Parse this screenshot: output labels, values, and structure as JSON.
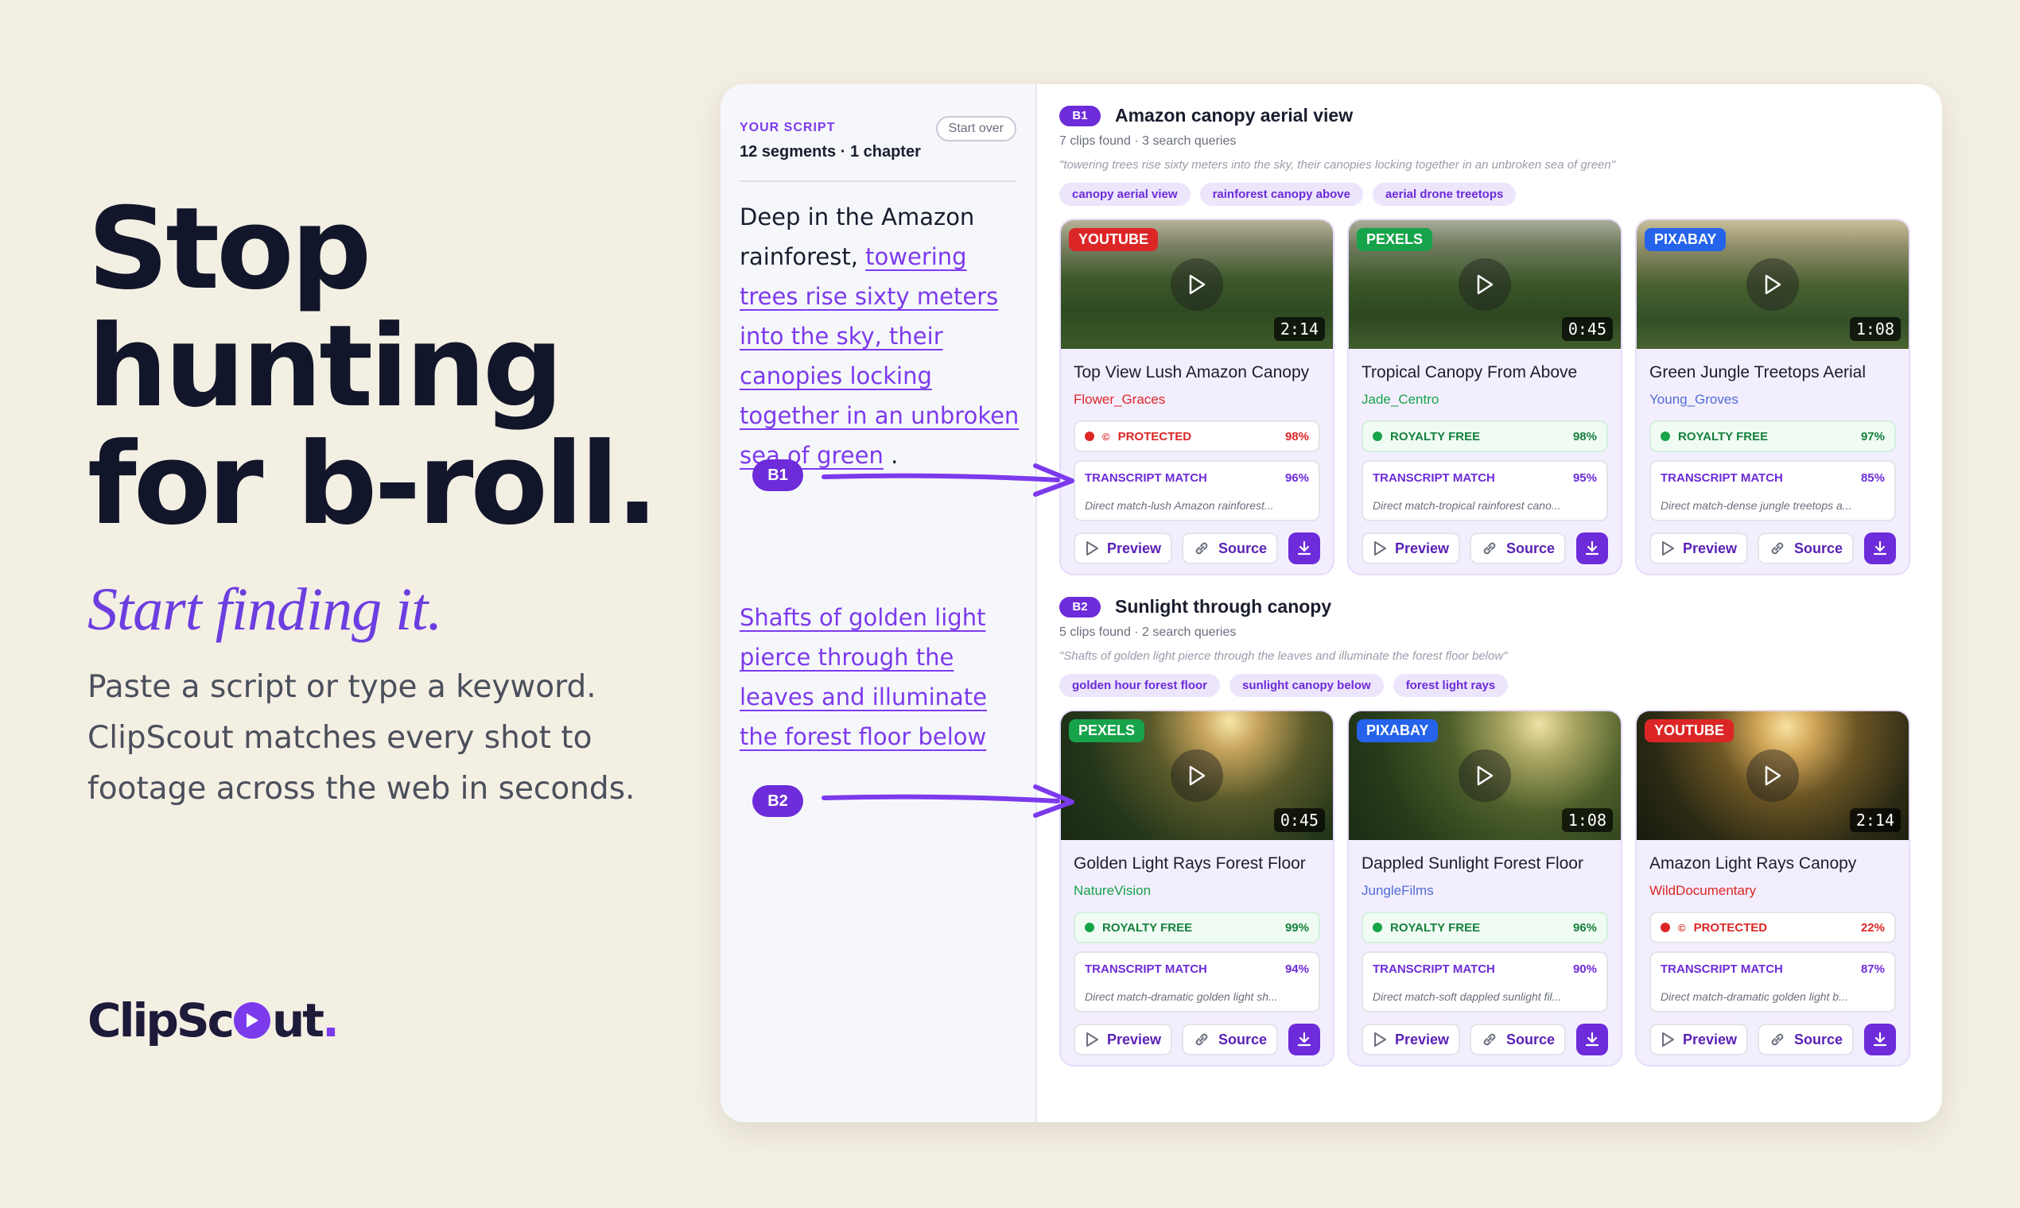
{
  "hero": {
    "headline_lines": [
      "Stop",
      "hunting",
      "for b-roll."
    ],
    "subhead": "Start finding it.",
    "description": "Paste a script or type a keyword. ClipScout matches every shot to footage across the web in seconds."
  },
  "logo": {
    "part1": "ClipSc",
    "part2": "ut",
    "dot": "."
  },
  "script_panel": {
    "label": "YOUR SCRIPT",
    "summary": "12 segments · 1 chapter",
    "start_over": "Start over",
    "para1_plain": "Deep in the Amazon rainforest, ",
    "para1_highlight": "towering trees rise sixty meters into the sky, their canopies locking together in an unbroken sea of green",
    "para1_end": " .",
    "para2_highlight": "Shafts of golden light pierce through the leaves and illuminate the forest floor below",
    "marker1": "B1",
    "marker2": "B2"
  },
  "sections": [
    {
      "badge": "B1",
      "title": "Amazon canopy aerial view",
      "meta": "7 clips found · 3 search queries",
      "quote": "\"towering trees rise sixty meters into the sky, their canopies locking together in an unbroken sea of green\"",
      "chips": [
        "canopy aerial view",
        "rainforest canopy above",
        "aerial drone treetops"
      ],
      "cards": [
        {
          "source": "YOUTUBE",
          "duration": "2:14",
          "title": "Top View Lush Amazon Canopy",
          "author": "Flower_Graces",
          "license": "PROTECTED",
          "license_score": "98%",
          "match_label": "TRANSCRIPT MATCH",
          "match_score": "96%",
          "match_desc": "Direct match-lush Amazon rainforest...",
          "preview": "Preview",
          "source_btn": "Source"
        },
        {
          "source": "PEXELS",
          "duration": "0:45",
          "title": "Tropical Canopy From Above",
          "author": "Jade_Centro",
          "license": "ROYALTY FREE",
          "license_score": "98%",
          "match_label": "TRANSCRIPT MATCH",
          "match_score": "95%",
          "match_desc": "Direct match-tropical rainforest cano...",
          "preview": "Preview",
          "source_btn": "Source"
        },
        {
          "source": "PIXABAY",
          "duration": "1:08",
          "title": "Green Jungle Treetops Aerial",
          "author": "Young_Groves",
          "license": "ROYALTY FREE",
          "license_score": "97%",
          "match_label": "TRANSCRIPT MATCH",
          "match_score": "85%",
          "match_desc": "Direct match-dense jungle treetops a...",
          "preview": "Preview",
          "source_btn": "Source"
        }
      ]
    },
    {
      "badge": "B2",
      "title": "Sunlight through canopy",
      "meta": "5 clips found · 2 search queries",
      "quote": "\"Shafts of golden light pierce through the leaves and illuminate the forest floor below\"",
      "chips": [
        "golden hour forest floor",
        "sunlight canopy below",
        "forest light rays"
      ],
      "cards": [
        {
          "source": "PEXELS",
          "duration": "0:45",
          "title": "Golden Light Rays Forest Floor",
          "author": "NatureVision",
          "license": "ROYALTY FREE",
          "license_score": "99%",
          "match_label": "TRANSCRIPT MATCH",
          "match_score": "94%",
          "match_desc": "Direct match-dramatic golden light sh...",
          "preview": "Preview",
          "source_btn": "Source"
        },
        {
          "source": "PIXABAY",
          "duration": "1:08",
          "title": "Dappled Sunlight Forest Floor",
          "author": "JungleFilms",
          "license": "ROYALTY FREE",
          "license_score": "96%",
          "match_label": "TRANSCRIPT MATCH",
          "match_score": "90%",
          "match_desc": "Direct match-soft dappled sunlight fil...",
          "preview": "Preview",
          "source_btn": "Source"
        },
        {
          "source": "YOUTUBE",
          "duration": "2:14",
          "title": "Amazon Light Rays Canopy",
          "author": "WildDocumentary",
          "license": "PROTECTED",
          "license_score": "22%",
          "match_label": "TRANSCRIPT MATCH",
          "match_score": "87%",
          "match_desc": "Direct match-dramatic golden light b...",
          "preview": "Preview",
          "source_btn": "Source"
        }
      ]
    }
  ],
  "colors": {
    "accent": "#6d2bd9",
    "youtube": "#dc2626",
    "pexels": "#16a34a",
    "pixabay": "#2563eb",
    "background": "#f4efe3"
  }
}
